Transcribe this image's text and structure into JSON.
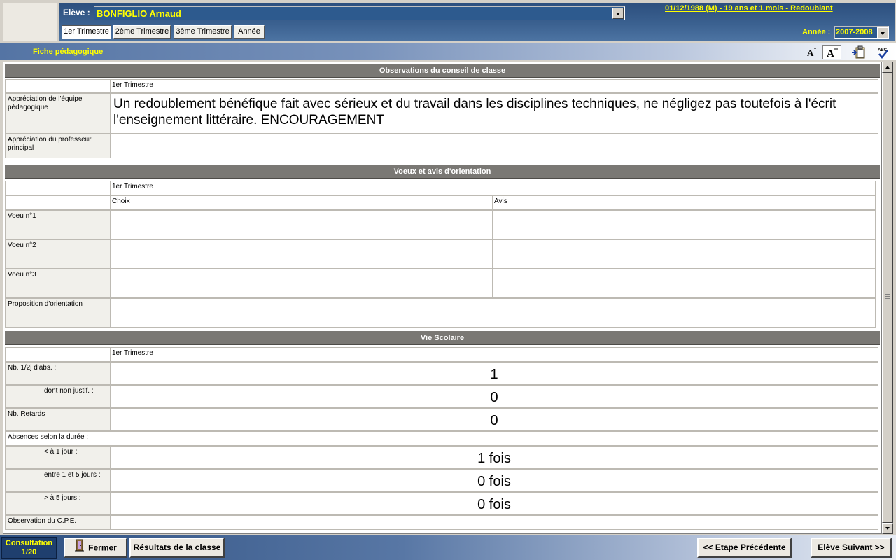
{
  "header": {
    "student_label": "Elève :",
    "student_name": "BONFIGLIO Arnaud",
    "birth_info": "01/12/1988 (M) - 19 ans et 1 mois - Redoublant",
    "tabs": [
      "1er Trimestre",
      "2ème Trimestre",
      "3ème Trimestre",
      "Année"
    ],
    "active_tab": "1er Trimestre",
    "year_label": "Année :",
    "year_value": "2007-2008"
  },
  "titlebar": {
    "title": "Fiche pédagogique",
    "tools": [
      "font-decrease-icon",
      "font-increase-icon",
      "clipboard-icon",
      "spellcheck-icon"
    ]
  },
  "sections": {
    "conseil": {
      "title": "Observations du conseil de classe",
      "period": "1er Trimestre",
      "rows": [
        {
          "label": "Appréciation de l'équipe pédagogique",
          "value": "Un redoublement bénéfique fait avec sérieux et du travail dans les disciplines techniques, ne négligez pas toutefois à l'écrit l'enseignement littéraire. ENCOURAGEMENT"
        },
        {
          "label": "Appréciation du professeur principal",
          "value": ""
        }
      ]
    },
    "orientation": {
      "title": "Voeux et avis d'orientation",
      "period": "1er Trimestre",
      "col_choix": "Choix",
      "col_avis": "Avis",
      "rows": [
        {
          "label": "Voeu n°1",
          "choix": "",
          "avis": ""
        },
        {
          "label": "Voeu n°2",
          "choix": "",
          "avis": ""
        },
        {
          "label": "Voeu n°3",
          "choix": "",
          "avis": ""
        }
      ],
      "proposition_label": "Proposition d'orientation",
      "proposition_value": ""
    },
    "vie_scolaire": {
      "title": "Vie Scolaire",
      "period": "1er Trimestre",
      "rows": [
        {
          "label": "Nb. 1/2j d'abs. :",
          "value": "1"
        },
        {
          "label": "dont non justif. :",
          "value": "0"
        },
        {
          "label": "Nb. Retards :",
          "value": "0"
        },
        {
          "label": "Absences selon la durée :",
          "value": ""
        },
        {
          "label": "< à 1 jour :",
          "value": "1 fois"
        },
        {
          "label": "entre 1 et 5 jours :",
          "value": "0 fois"
        },
        {
          "label": "> à 5 jours :",
          "value": "0 fois"
        },
        {
          "label": "Observation du C.P.E.",
          "value": ""
        }
      ]
    }
  },
  "footer": {
    "consultation_label": "Consultation",
    "consultation_count": "1/20",
    "close_label": "Fermer",
    "class_results_label": "Résultats de la classe",
    "prev_label": "<< Etape Précédente",
    "next_label": "Elève Suivant >>"
  },
  "colors": {
    "accent_yellow": "#ffff00",
    "header_blue": "#2c4f7e",
    "section_gray": "#7a7874"
  }
}
